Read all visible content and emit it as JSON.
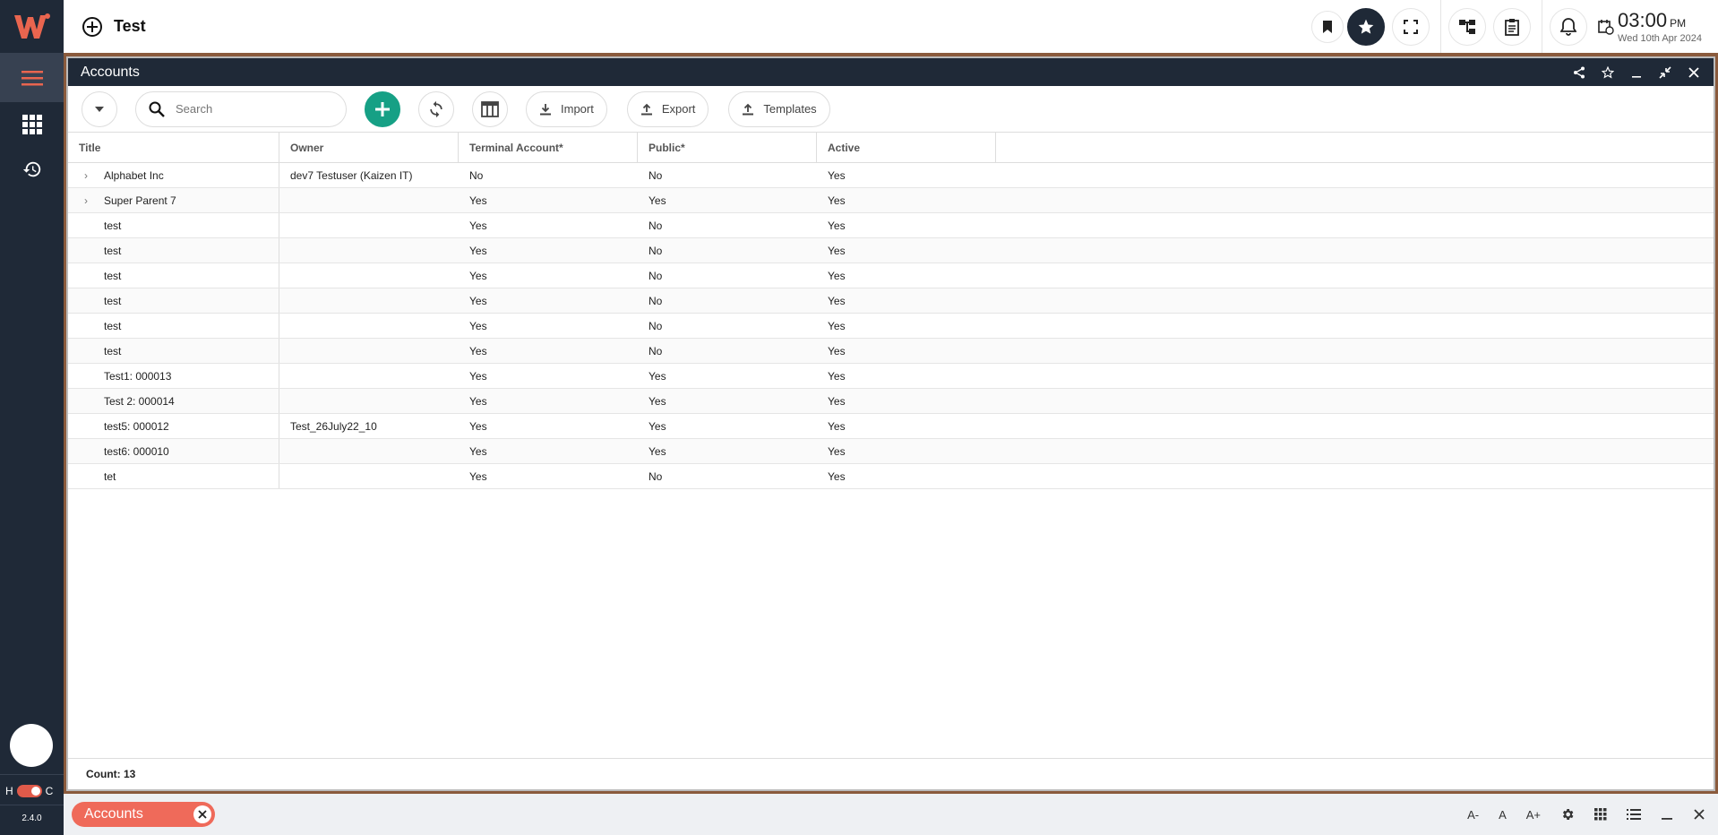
{
  "app": {
    "title": "Test",
    "version": "2.4.0",
    "toggle_left": "H",
    "toggle_right": "C"
  },
  "clock": {
    "time": "03:00",
    "ampm": "PM",
    "date": "Wed 10th Apr 2024"
  },
  "window": {
    "title": "Accounts"
  },
  "toolbar": {
    "search_placeholder": "Search",
    "import_label": "Import",
    "export_label": "Export",
    "templates_label": "Templates"
  },
  "table": {
    "headers": [
      "Title",
      "Owner",
      "Terminal Account*",
      "Public*",
      "Active"
    ],
    "rows": [
      {
        "expandable": true,
        "title": "Alphabet Inc",
        "owner": "dev7 Testuser (Kaizen IT)",
        "terminal": "No",
        "public": "No",
        "active": "Yes"
      },
      {
        "expandable": true,
        "title": "Super Parent 7",
        "owner": "",
        "terminal": "Yes",
        "public": "Yes",
        "active": "Yes"
      },
      {
        "expandable": false,
        "title": "test",
        "owner": "",
        "terminal": "Yes",
        "public": "No",
        "active": "Yes"
      },
      {
        "expandable": false,
        "title": "test",
        "owner": "",
        "terminal": "Yes",
        "public": "No",
        "active": "Yes"
      },
      {
        "expandable": false,
        "title": "test",
        "owner": "",
        "terminal": "Yes",
        "public": "No",
        "active": "Yes"
      },
      {
        "expandable": false,
        "title": "test",
        "owner": "",
        "terminal": "Yes",
        "public": "No",
        "active": "Yes"
      },
      {
        "expandable": false,
        "title": "test",
        "owner": "",
        "terminal": "Yes",
        "public": "No",
        "active": "Yes"
      },
      {
        "expandable": false,
        "title": "test",
        "owner": "",
        "terminal": "Yes",
        "public": "No",
        "active": "Yes"
      },
      {
        "expandable": false,
        "title": "Test1: 000013",
        "owner": "",
        "terminal": "Yes",
        "public": "Yes",
        "active": "Yes"
      },
      {
        "expandable": false,
        "title": "Test 2: 000014",
        "owner": "",
        "terminal": "Yes",
        "public": "Yes",
        "active": "Yes"
      },
      {
        "expandable": false,
        "title": "test5: 000012",
        "owner": "Test_26July22_10",
        "terminal": "Yes",
        "public": "Yes",
        "active": "Yes"
      },
      {
        "expandable": false,
        "title": "test6: 000010",
        "owner": "",
        "terminal": "Yes",
        "public": "Yes",
        "active": "Yes"
      },
      {
        "expandable": false,
        "title": "tet",
        "owner": "",
        "terminal": "Yes",
        "public": "No",
        "active": "Yes"
      }
    ],
    "count_label": "Count: 13"
  },
  "taskbar": {
    "tab_label": "Accounts",
    "font_decrease": "A-",
    "font_normal": "A",
    "font_increase": "A+"
  },
  "colors": {
    "sidebar": "#1f2937",
    "accent": "#ef6a5a",
    "add_button": "#16a085"
  }
}
